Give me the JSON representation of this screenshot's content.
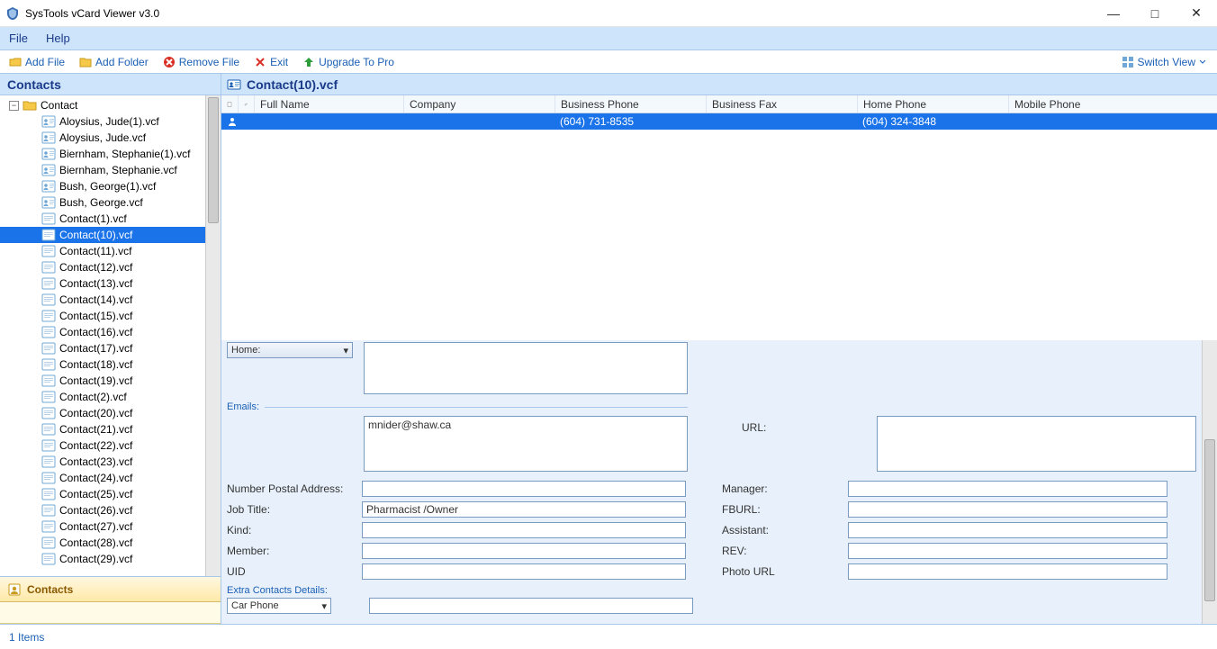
{
  "app": {
    "title": "SysTools vCard Viewer v3.0"
  },
  "win": {
    "min": "—",
    "max": "□",
    "close": "✕"
  },
  "menu": {
    "file": "File",
    "help": "Help"
  },
  "toolbar": {
    "add_file": "Add File",
    "add_folder": "Add Folder",
    "remove_file": "Remove File",
    "exit": "Exit",
    "upgrade": "Upgrade To Pro",
    "switch_view": "Switch View"
  },
  "left": {
    "header": "Contacts",
    "root": "Contact",
    "items": [
      "Aloysius, Jude(1).vcf",
      "Aloysius, Jude.vcf",
      "Biernham, Stephanie(1).vcf",
      "Biernham, Stephanie.vcf",
      "Bush, George(1).vcf",
      "Bush, George.vcf",
      "Contact(1).vcf",
      "Contact(10).vcf",
      "Contact(11).vcf",
      "Contact(12).vcf",
      "Contact(13).vcf",
      "Contact(14).vcf",
      "Contact(15).vcf",
      "Contact(16).vcf",
      "Contact(17).vcf",
      "Contact(18).vcf",
      "Contact(19).vcf",
      "Contact(2).vcf",
      "Contact(20).vcf",
      "Contact(21).vcf",
      "Contact(22).vcf",
      "Contact(23).vcf",
      "Contact(24).vcf",
      "Contact(25).vcf",
      "Contact(26).vcf",
      "Contact(27).vcf",
      "Contact(28).vcf",
      "Contact(29).vcf"
    ],
    "selected_index": 7,
    "nav_footer": "Contacts"
  },
  "content": {
    "title": "Contact(10).vcf",
    "columns": {
      "full_name": "Full Name",
      "company": "Company",
      "business_phone": "Business Phone",
      "business_fax": "Business Fax",
      "home_phone": "Home Phone",
      "mobile_phone": "Mobile Phone"
    },
    "row": {
      "full_name": "",
      "company": "",
      "business_phone": "(604) 731-8535",
      "business_fax": "",
      "home_phone": "(604) 324-3848",
      "mobile_phone": ""
    }
  },
  "details": {
    "address_type": "Home:",
    "emails_section": "Emails:",
    "email_value": "mnider@shaw.ca",
    "url_label": "URL:",
    "labels": {
      "num_postal": "Number Postal Address:",
      "job_title": "Job Title:",
      "kind": "Kind:",
      "member": "Member:",
      "uid": "UID",
      "manager": "Manager:",
      "fburl": "FBURL:",
      "assistant": "Assistant:",
      "rev": "REV:",
      "photo_url": "Photo URL"
    },
    "values": {
      "num_postal": "",
      "job_title": "Pharmacist /Owner",
      "kind": "",
      "member": "",
      "uid": "",
      "manager": "",
      "fburl": "",
      "assistant": "",
      "rev": "",
      "photo_url": ""
    },
    "extra_section": "Extra Contacts Details:",
    "extra_type": "Car Phone"
  },
  "status": {
    "text": "1 Items"
  }
}
